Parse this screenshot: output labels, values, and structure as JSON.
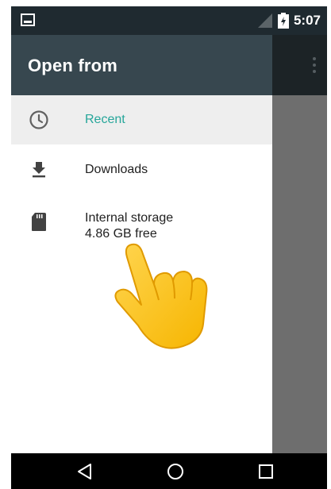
{
  "status_bar": {
    "time": "5:07",
    "left_icon": "image-notification-icon",
    "signal_icon": "signal-icon",
    "battery_icon": "battery-charging-icon"
  },
  "drawer": {
    "title": "Open from",
    "items": [
      {
        "label": "Recent",
        "icon": "clock-icon",
        "selected": true
      },
      {
        "label": "Downloads",
        "icon": "download-icon",
        "selected": false
      },
      {
        "label": "Internal storage",
        "sublabel": "4.86 GB free",
        "icon": "sd-card-icon",
        "selected": false
      }
    ]
  },
  "app_bar": {
    "overflow_icon": "more-vert-icon"
  },
  "nav_bar": {
    "buttons": [
      "back-icon",
      "home-icon",
      "recents-icon"
    ]
  },
  "overlay": {
    "icon": "pointing-hand-icon"
  },
  "colors": {
    "status_bar": "#1f2a30",
    "drawer_header": "#37474f",
    "accent": "#26a69a",
    "selected_row": "#eeeeee",
    "scrim": "#6e6e6e"
  }
}
